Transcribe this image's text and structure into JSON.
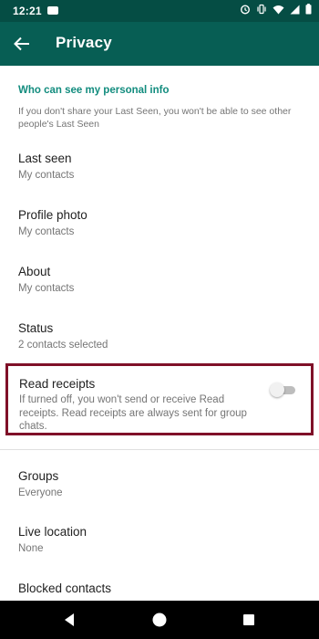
{
  "status_bar": {
    "time": "12:21",
    "icons": [
      "app-notification-icon",
      "alarm-icon",
      "vibrate-icon",
      "wifi-icon",
      "signal-icon",
      "battery-icon"
    ]
  },
  "header": {
    "title": "Privacy",
    "back_icon": "back-arrow-icon"
  },
  "section": {
    "header": "Who can see my personal info",
    "description": "If you don't share your Last Seen, you won't be able to see other people's Last Seen"
  },
  "items": [
    {
      "title": "Last seen",
      "subtitle": "My contacts"
    },
    {
      "title": "Profile photo",
      "subtitle": "My contacts"
    },
    {
      "title": "About",
      "subtitle": "My contacts"
    },
    {
      "title": "Status",
      "subtitle": "2 contacts selected"
    }
  ],
  "read_receipts": {
    "title": "Read receipts",
    "description": "If turned off, you won't send or receive Read receipts. Read receipts are always sent for group chats.",
    "enabled": false
  },
  "items2": [
    {
      "title": "Groups",
      "subtitle": "Everyone"
    },
    {
      "title": "Live location",
      "subtitle": "None"
    },
    {
      "title": "Blocked contacts",
      "subtitle": ""
    }
  ],
  "colors": {
    "status_bar": "#054d44",
    "app_bar": "#075e54",
    "accent": "#128c7e",
    "highlight_border": "#7f1028",
    "toggle_off": "#bdbdbd"
  },
  "nav": {
    "buttons": [
      "back-triangle-icon",
      "home-circle-icon",
      "recents-square-icon"
    ]
  }
}
